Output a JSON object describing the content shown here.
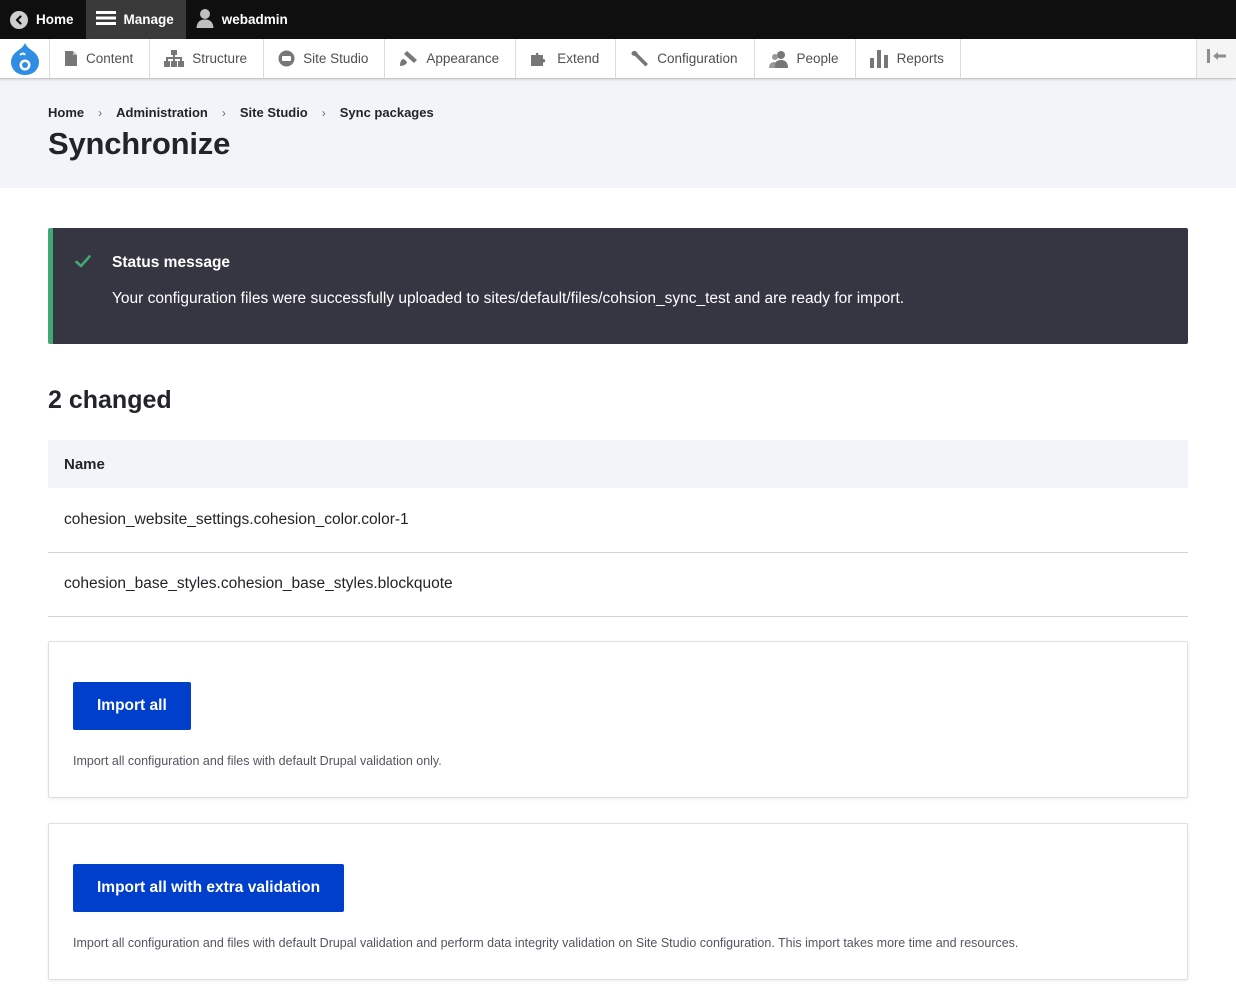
{
  "toolbar": {
    "home_label": "Home",
    "manage_label": "Manage",
    "user_label": "webadmin"
  },
  "tray": {
    "items": [
      {
        "label": "Content",
        "icon": "file-icon"
      },
      {
        "label": "Structure",
        "icon": "sitemap-icon"
      },
      {
        "label": "Site Studio",
        "icon": "site-studio-icon"
      },
      {
        "label": "Appearance",
        "icon": "paintbrush-icon"
      },
      {
        "label": "Extend",
        "icon": "puzzle-icon"
      },
      {
        "label": "Configuration",
        "icon": "wrench-icon"
      },
      {
        "label": "People",
        "icon": "people-icon"
      },
      {
        "label": "Reports",
        "icon": "bar-chart-icon"
      }
    ]
  },
  "breadcrumb": [
    "Home",
    "Administration",
    "Site Studio",
    "Sync packages"
  ],
  "page_title": "Synchronize",
  "status": {
    "title": "Status message",
    "text": "Your configuration files were successfully uploaded to sites/default/files/cohsion_sync_test and are ready for import.",
    "accent_color": "#42a877"
  },
  "changed_heading": "2 changed",
  "table": {
    "header": "Name",
    "rows": [
      "cohesion_website_settings.cohesion_color.color-1",
      "cohesion_base_styles.cohesion_base_styles.blockquote"
    ]
  },
  "import_all": {
    "button": "Import all",
    "description": "Import all configuration and files with default Drupal validation only."
  },
  "import_extra": {
    "button": "Import all with extra validation",
    "description": "Import all configuration and files with default Drupal validation and perform data integrity validation on Site Studio configuration. This import takes more time and resources."
  },
  "colors": {
    "primary_button": "#003ecc",
    "status_background": "#353641",
    "header_background": "#f3f4f9"
  }
}
